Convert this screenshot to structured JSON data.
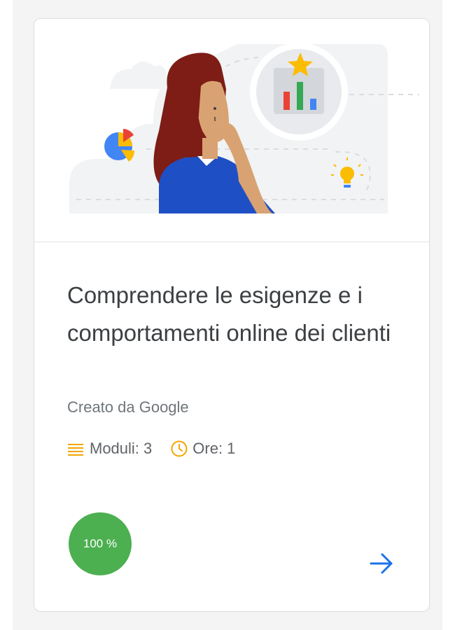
{
  "course": {
    "title": "Comprendere le esigenze e i comportamenti online dei clienti",
    "author": "Creato da Google",
    "modules_label": "Moduli: 3",
    "hours_label": "Ore: 1",
    "progress_label": "100 %",
    "progress_value": 1.0
  },
  "icons": {
    "modules": "list-icon",
    "hours": "clock-icon",
    "open": "arrow-right-icon"
  },
  "colors": {
    "progress_green": "#4caf50",
    "icon_yellow": "#f2a600",
    "arrow_blue": "#1a73e8",
    "title_text": "#3c4043",
    "secondary_text": "#70757a"
  }
}
